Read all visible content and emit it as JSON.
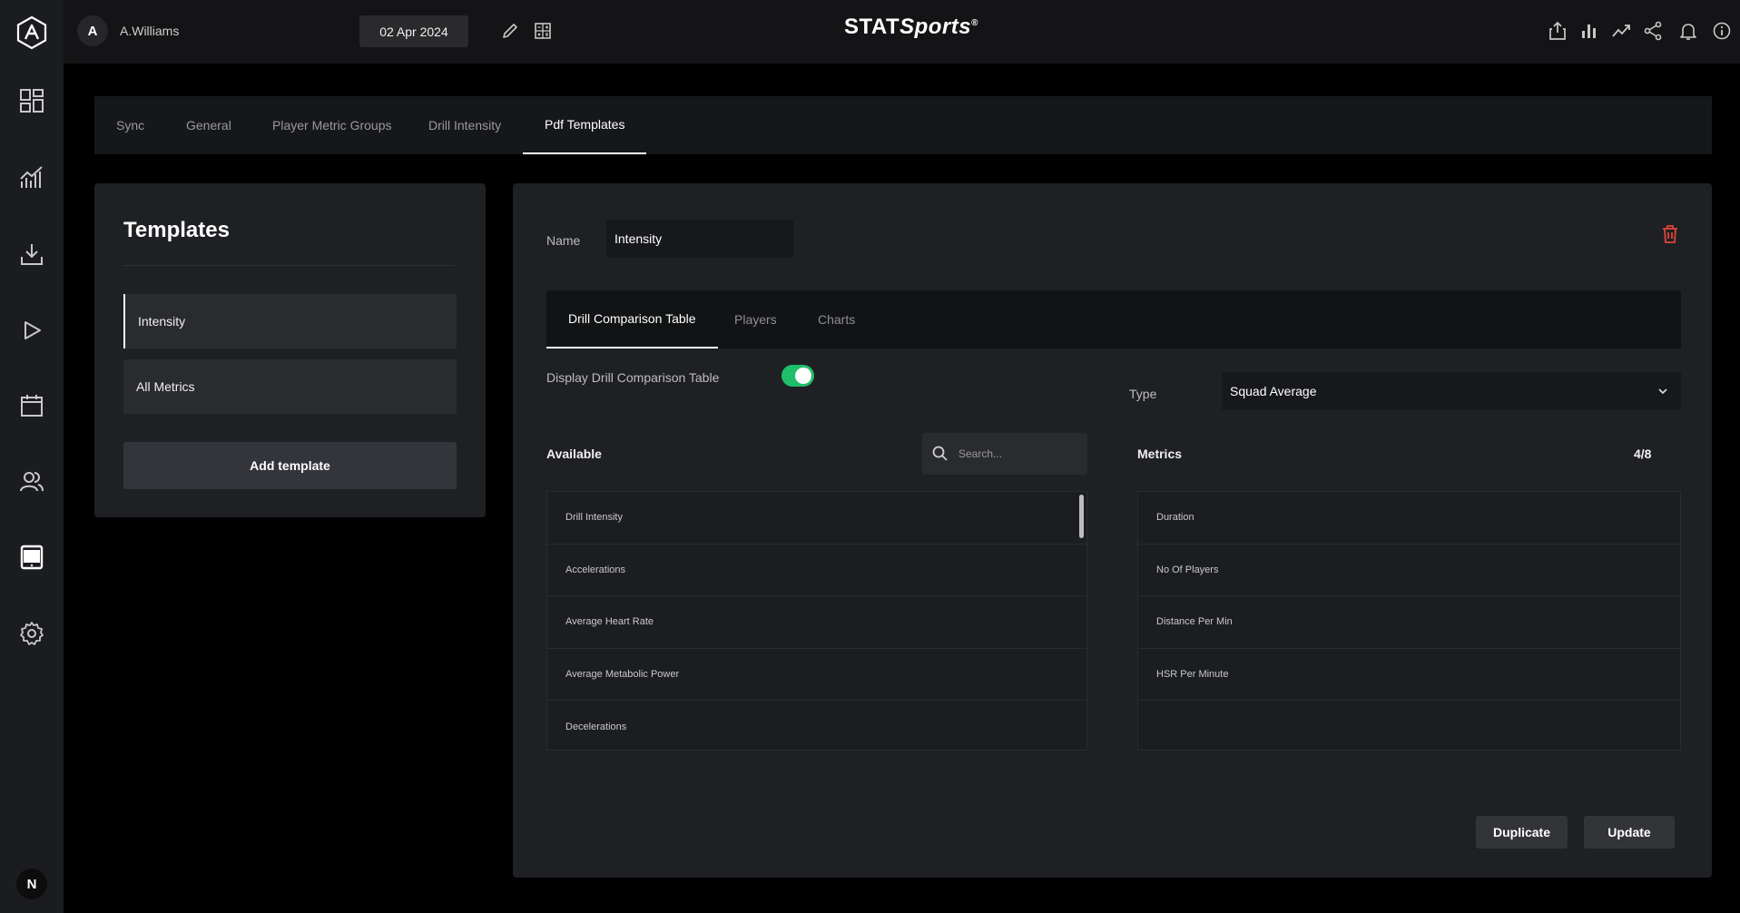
{
  "user": {
    "initial": "A",
    "name": "A.Williams"
  },
  "date": "02 Apr 2024",
  "brand": {
    "main": "STAT",
    "sub": "Sports",
    "mark": "®"
  },
  "rail": {
    "icons": [
      "app-logo",
      "dashboard-icon",
      "analytics-icon",
      "download-icon",
      "play-icon",
      "calendar-icon",
      "team-icon",
      "tablet-icon",
      "settings-icon"
    ],
    "bottom_initial": "N"
  },
  "settings_tabs": [
    "Sync",
    "General",
    "Player Metric Groups",
    "Drill Intensity",
    "Pdf Templates"
  ],
  "settings_active": "Pdf Templates",
  "templates": {
    "title": "Templates",
    "items": [
      "Intensity",
      "All Metrics"
    ],
    "selected": "Intensity",
    "add_label": "Add template"
  },
  "editor": {
    "name_label": "Name",
    "name_value": "Intensity",
    "tabs": [
      "Drill Comparison Table",
      "Players",
      "Charts"
    ],
    "active_tab": "Drill Comparison Table",
    "display_label": "Display Drill Comparison Table",
    "display_enabled": true,
    "type_label": "Type",
    "type_value": "Squad Average",
    "available_label": "Available",
    "search_placeholder": "Search...",
    "metrics_label": "Metrics",
    "metrics_count": "4/8",
    "available_items": [
      "Drill Intensity",
      "Accelerations",
      "Average Heart Rate",
      "Average Metabolic Power",
      "Decelerations"
    ],
    "metric_items": [
      "Duration",
      "No Of Players",
      "Distance Per Min",
      "HSR Per Minute"
    ],
    "duplicate_label": "Duplicate",
    "update_label": "Update"
  },
  "colors": {
    "toggle_on": "#1fbe6b",
    "delete": "#e0453a",
    "background": "#000000",
    "panel": "#1f2023"
  }
}
